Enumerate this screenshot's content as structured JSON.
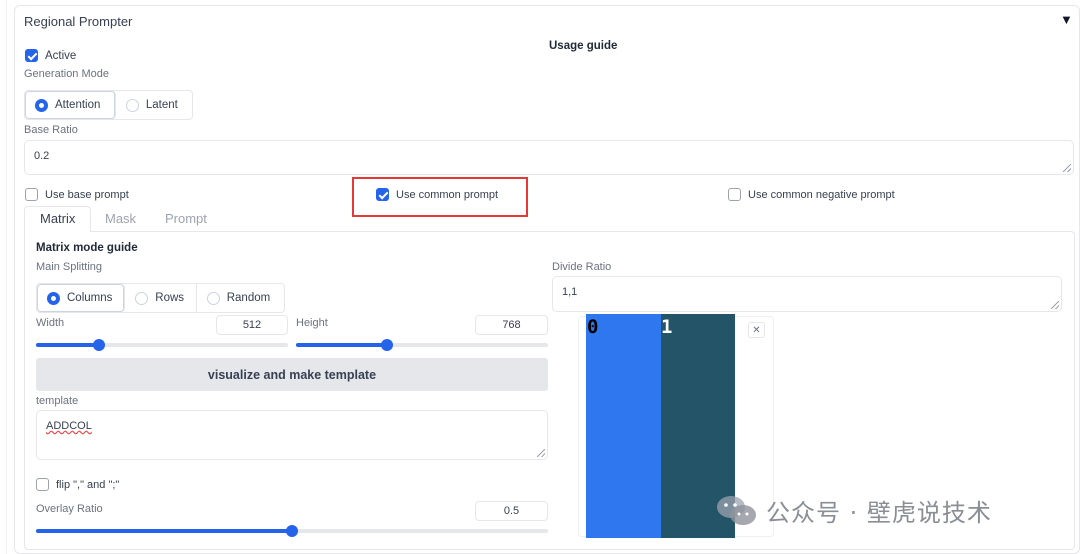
{
  "panel": {
    "title": "Regional Prompter",
    "collapse_icon": "triangle-down-icon",
    "active_label": "Active",
    "active_checked": true,
    "usage_guide": "Usage guide",
    "generation_mode_label": "Generation Mode",
    "generation_modes": [
      {
        "label": "Attention",
        "selected": true
      },
      {
        "label": "Latent",
        "selected": false
      }
    ],
    "base_ratio_label": "Base Ratio",
    "base_ratio_value": "0.2",
    "use_base_prompt": {
      "label": "Use base prompt",
      "checked": false
    },
    "use_common_prompt": {
      "label": "Use common prompt",
      "checked": true,
      "highlight_color": "#e53935"
    },
    "use_common_negative_prompt": {
      "label": "Use common negative prompt",
      "checked": false
    }
  },
  "tabs": [
    {
      "label": "Matrix",
      "active": true
    },
    {
      "label": "Mask",
      "active": false
    },
    {
      "label": "Prompt",
      "active": false
    }
  ],
  "matrix": {
    "guide": "Matrix mode guide",
    "main_splitting_label": "Main Splitting",
    "splitting_options": [
      {
        "label": "Columns",
        "selected": true
      },
      {
        "label": "Rows",
        "selected": false
      },
      {
        "label": "Random",
        "selected": false
      }
    ],
    "divide_ratio_label": "Divide Ratio",
    "divide_ratio_value": "1,1",
    "width_label": "Width",
    "width_value": "512",
    "width_fraction": 0.25,
    "height_label": "Height",
    "height_value": "768",
    "height_fraction": 0.36,
    "visualize_button": "visualize and make template",
    "template_label": "template",
    "template_value": "ADDCOL",
    "flip_label": "flip \",\" and \";\"",
    "flip_checked": false,
    "overlay_ratio_label": "Overlay Ratio",
    "overlay_ratio_value": "0.5",
    "overlay_fraction": 0.5
  },
  "preview": {
    "region_labels": [
      "0",
      "1"
    ],
    "region_colors": [
      "#2f77ee",
      "#235468"
    ],
    "close_icon": "close-icon"
  },
  "watermark": {
    "text": "公众号 · 壁虎说技术",
    "icon": "wechat-icon"
  },
  "colors": {
    "accent": "#2563eb"
  }
}
